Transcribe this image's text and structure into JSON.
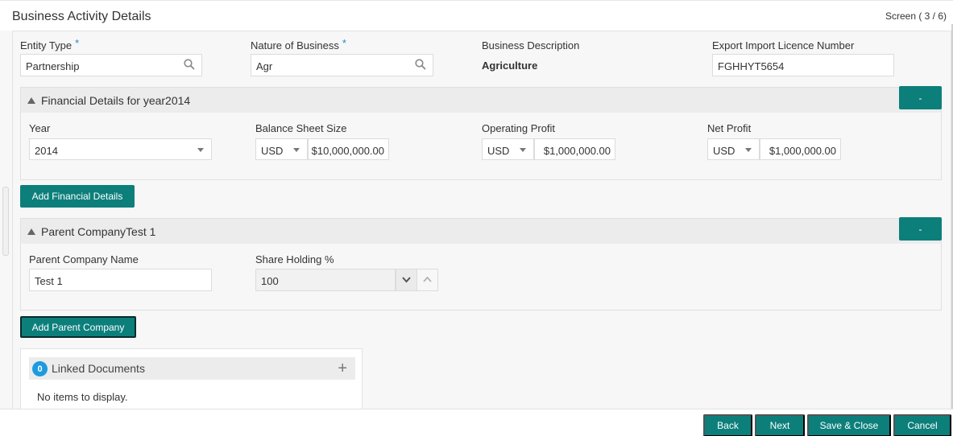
{
  "header": {
    "title": "Business Activity Details",
    "screen_indicator": "Screen ( 3 / 6)"
  },
  "business": {
    "entity_type": {
      "label": "Entity Type",
      "required": "*",
      "value": "Partnership"
    },
    "nature_of_business": {
      "label": "Nature of Business",
      "required": "*",
      "value": "Agr"
    },
    "business_description": {
      "label": "Business Description",
      "value": "Agriculture"
    },
    "export_import_licence": {
      "label": "Export Import Licence Number",
      "value": "FGHHYT5654"
    }
  },
  "financial_panel": {
    "title": "Financial Details for year2014",
    "collapse_label": "-",
    "year": {
      "label": "Year",
      "value": "2014"
    },
    "balance_sheet": {
      "label": "Balance Sheet Size",
      "currency": "USD",
      "amount": "$10,000,000.00"
    },
    "operating_profit": {
      "label": "Operating Profit",
      "currency": "USD",
      "amount": "$1,000,000.00"
    },
    "net_profit": {
      "label": "Net Profit",
      "currency": "USD",
      "amount": "$1,000,000.00"
    },
    "add_button": "Add Financial Details"
  },
  "parent_panel": {
    "title": "Parent CompanyTest 1",
    "collapse_label": "-",
    "parent_name": {
      "label": "Parent Company Name",
      "value": "Test 1"
    },
    "share_holding": {
      "label": "Share Holding %",
      "value": "100"
    },
    "add_button": "Add Parent Company"
  },
  "linked_documents": {
    "count": "0",
    "title": "Linked Documents",
    "add_icon": "+",
    "empty_message": "No items to display."
  },
  "footer": {
    "back": "Back",
    "next": "Next",
    "save_close": "Save & Close",
    "cancel": "Cancel"
  },
  "colors": {
    "accent": "#0c7f7b",
    "badge": "#1e9be0",
    "required": "#2a8ac7"
  },
  "icons": [
    "search-icon",
    "collapse-triangle-icon",
    "chevron-down-icon",
    "chevron-up-icon",
    "plus-icon"
  ]
}
